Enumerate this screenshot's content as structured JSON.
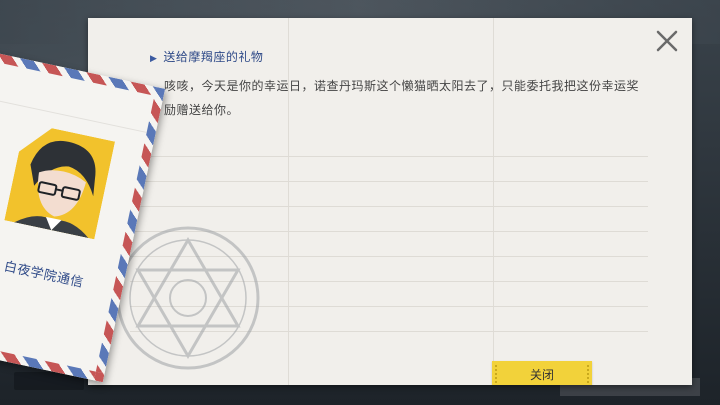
{
  "letter": {
    "subject": "送给摩羯座的礼物",
    "body": "咳咳，今天是你的幸运日，诺查丹玛斯这个懒猫晒太阳去了，只能委托我把这份幸运奖励赠送给你。",
    "close_button_label": "关闭"
  },
  "envelope": {
    "sender": "白夜学院通信"
  },
  "icons": {
    "subject_marker": "▶",
    "close": "close-icon",
    "emblem": "hexagram-emblem-icon",
    "portrait": "character-portrait"
  },
  "colors": {
    "accent_yellow": "#f2d23a",
    "text_blue": "#2f4a88",
    "airmail_red": "#c65656",
    "airmail_blue": "#5a78b8",
    "paper": "#f1efeb"
  }
}
